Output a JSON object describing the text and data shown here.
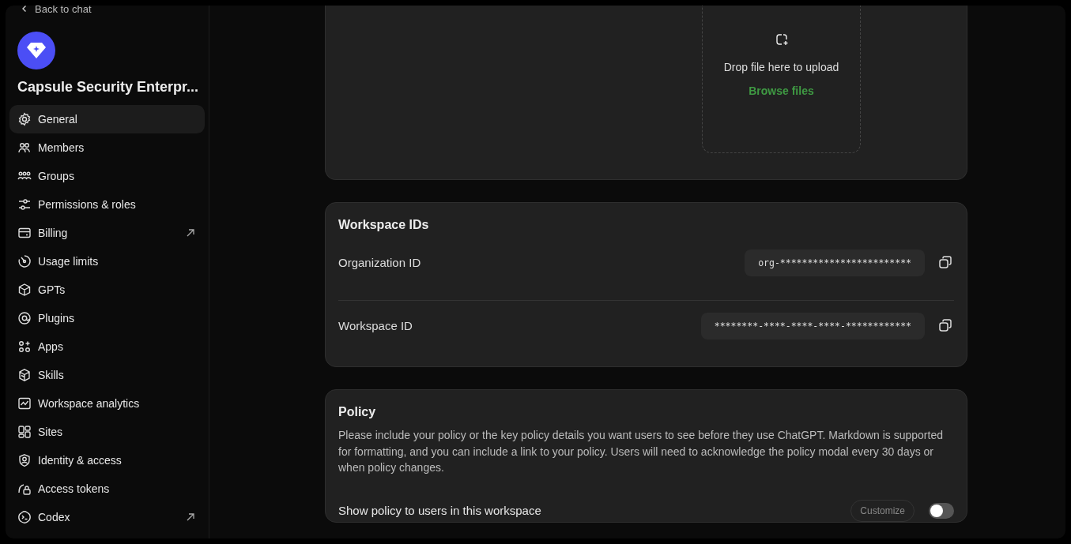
{
  "sidebar": {
    "back_link": "Back to chat",
    "workspace_name": "Capsule Security Enterpr...",
    "items": [
      {
        "label": "General",
        "selected": true,
        "external": false
      },
      {
        "label": "Members",
        "selected": false,
        "external": false
      },
      {
        "label": "Groups",
        "selected": false,
        "external": false
      },
      {
        "label": "Permissions & roles",
        "selected": false,
        "external": false
      },
      {
        "label": "Billing",
        "selected": false,
        "external": true
      },
      {
        "label": "Usage limits",
        "selected": false,
        "external": false
      },
      {
        "label": "GPTs",
        "selected": false,
        "external": false
      },
      {
        "label": "Plugins",
        "selected": false,
        "external": false
      },
      {
        "label": "Apps",
        "selected": false,
        "external": false
      },
      {
        "label": "Skills",
        "selected": false,
        "external": false
      },
      {
        "label": "Workspace analytics",
        "selected": false,
        "external": false
      },
      {
        "label": "Sites",
        "selected": false,
        "external": false
      },
      {
        "label": "Identity & access",
        "selected": false,
        "external": false
      },
      {
        "label": "Access tokens",
        "selected": false,
        "external": false
      },
      {
        "label": "Codex",
        "selected": false,
        "external": true
      }
    ]
  },
  "upload": {
    "text": "Drop file here to upload",
    "link": "Browse files"
  },
  "workspace_ids": {
    "title": "Workspace IDs",
    "rows": [
      {
        "label": "Organization ID",
        "value": "org-************************"
      },
      {
        "label": "Workspace ID",
        "value": "********-****-****-****-************"
      }
    ]
  },
  "policy": {
    "title": "Policy",
    "description": "Please include your policy or the key policy details you want users to see before they use ChatGPT. Markdown is supported for formatting, and you can include a link to your policy. Users will need to acknowledge the policy modal every 30 days or when policy changes.",
    "setting": {
      "label": "Show policy to users in this workspace",
      "button": "Customize",
      "button_disabled": true,
      "on": false
    }
  }
}
